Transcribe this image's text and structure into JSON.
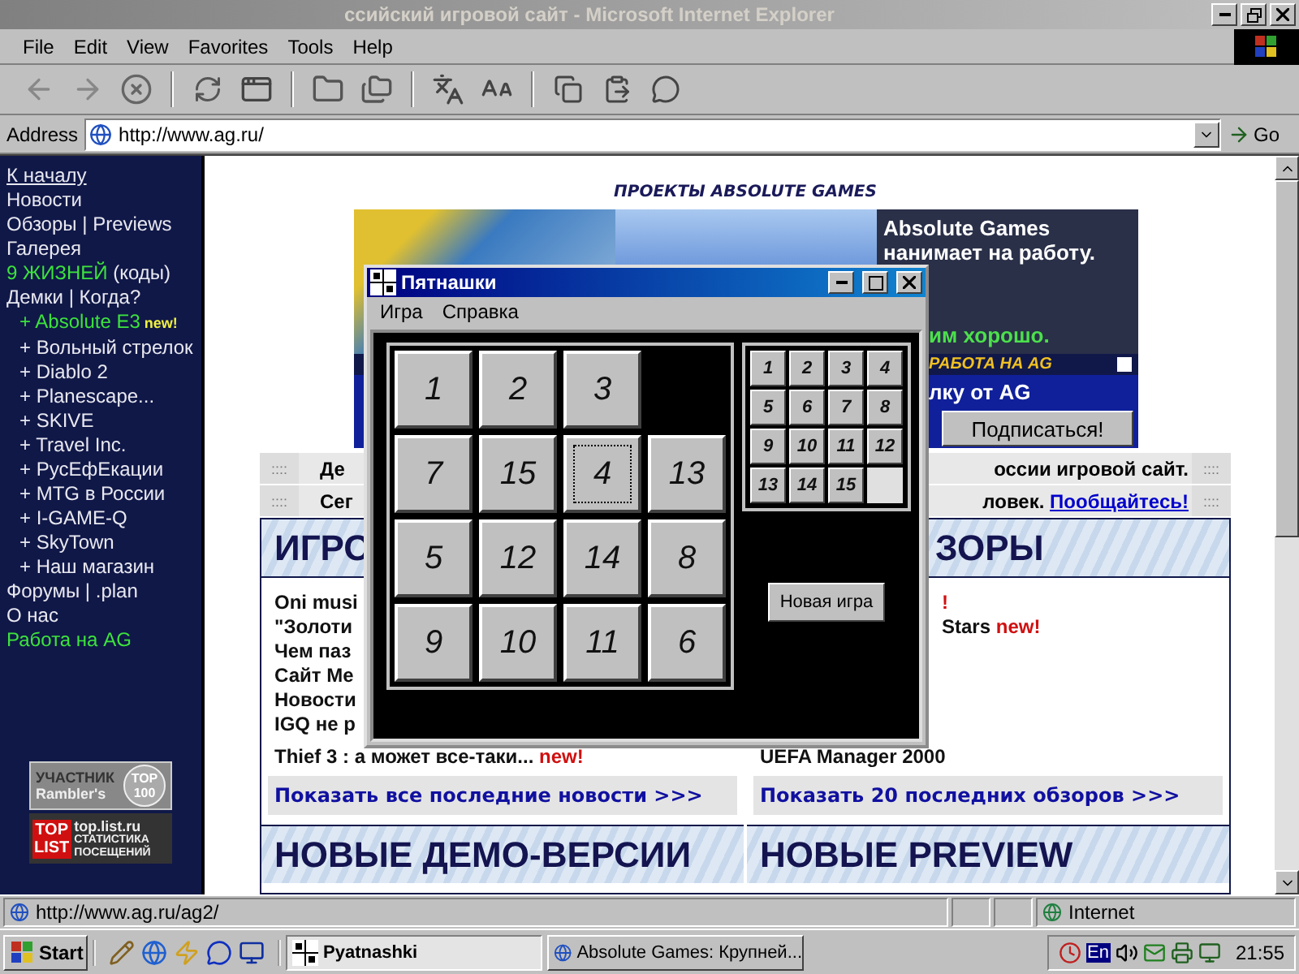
{
  "browser": {
    "title": "ссийский игровой сайт - Microsoft Internet Explorer",
    "menu": [
      "File",
      "Edit",
      "View",
      "Favorites",
      "Tools",
      "Help"
    ],
    "address_label": "Address",
    "address": "http://www.ag.ru/",
    "go": "Go"
  },
  "sidebar": {
    "items": [
      {
        "text": "К началу",
        "kind": "home"
      },
      {
        "text": "Новости",
        "kind": "link"
      },
      {
        "text": "Обзоры | Previews",
        "kind": "link"
      },
      {
        "text": "Галерея",
        "kind": "link"
      },
      {
        "text": "9 ЖИЗНЕЙ",
        "extra": "(коды)",
        "kind": "highlight"
      },
      {
        "text": "Демки | Когда?",
        "kind": "link",
        "children": [
          {
            "text": "+ Absolute E3",
            "badge": "new!",
            "kind": "highlight"
          },
          {
            "text": "+ Вольный стрелок",
            "kind": "link"
          },
          {
            "text": "+ Diablo 2",
            "kind": "link"
          },
          {
            "text": "+ Planescape...",
            "kind": "link"
          },
          {
            "text": "+ SKIVE",
            "kind": "link"
          },
          {
            "text": "+ Travel Inc.",
            "kind": "link"
          },
          {
            "text": "+ РусЕфЕкации",
            "kind": "link"
          },
          {
            "text": "+ MTG в России",
            "kind": "link"
          },
          {
            "text": "+ I-GAME-Q",
            "kind": "link"
          },
          {
            "text": "+ SkyTown",
            "kind": "link"
          },
          {
            "text": "+ Наш магазин",
            "kind": "link"
          }
        ]
      },
      {
        "text": "Форумы | .plan",
        "kind": "link"
      },
      {
        "text": "О нас",
        "kind": "link"
      },
      {
        "text": "Работа на AG",
        "kind": "highlight"
      }
    ],
    "rambler": {
      "top": "УЧАСТНИК",
      "name": "Rambler's",
      "rank": "TOP 100"
    },
    "toplist": {
      "logo": "TOP LIST",
      "site": "top.list.ru",
      "caption": "СТАТИСТИКА ПОСЕЩЕНИЙ"
    }
  },
  "page": {
    "heading": "ПРОЕКТЫ ABSOLUTE GAMES",
    "banner": {
      "title": "Absolute Games нанимает на работу.",
      "tagline": "им хорошо.",
      "strip": "РАБОТА НА AG",
      "subscribe_label": "лку от AG",
      "subscribe_button": "Подписаться!"
    },
    "notices": [
      {
        "marker_left": "::::",
        "left": "Де",
        "right": "оссии игровой сайт.",
        "marker_right": "::::"
      },
      {
        "marker_left": "::::",
        "left": "Сег",
        "right": "ловек.",
        "link": "Пообщайтесь!",
        "marker_right": "::::"
      }
    ],
    "panels": [
      {
        "kind": "head",
        "title": "ИГРО",
        "items": [
          {
            "text": "Oni musi"
          },
          {
            "text": "\"Золоти"
          },
          {
            "text": "Чем паз"
          },
          {
            "text": "Сайт Ме"
          },
          {
            "text": "Новости"
          },
          {
            "text": "IGQ не р"
          }
        ],
        "last_item": {
          "text": "Thief 3 : а может все-таки...",
          "badge": "new!"
        },
        "more": "Показать все последние новости >>>",
        "next_title": "НОВЫЕ ДЕМО-ВЕРСИИ"
      },
      {
        "kind": "tail",
        "title": "ЗОРЫ",
        "items": [
          {
            "badge": "!"
          },
          {
            "text": "Stars",
            "badge": "new!"
          }
        ],
        "last_item": {
          "text": "UEFA Manager 2000"
        },
        "more": "Показать 20 последних обзоров >>>",
        "next_title": "НОВЫЕ PREVIEW"
      }
    ]
  },
  "game": {
    "title": "Пятнашки",
    "menu": [
      "Игра",
      "Справка"
    ],
    "board": [
      {
        "kind": "tile",
        "label": "1",
        "focused": false
      },
      {
        "kind": "tile",
        "label": "2",
        "focused": false
      },
      {
        "kind": "tile",
        "label": "3",
        "focused": false
      },
      {
        "kind": "empty"
      },
      {
        "kind": "tile",
        "label": "7",
        "focused": false
      },
      {
        "kind": "tile",
        "label": "15",
        "focused": false
      },
      {
        "kind": "tile",
        "label": "4",
        "focused": true
      },
      {
        "kind": "tile",
        "label": "13",
        "focused": false
      },
      {
        "kind": "tile",
        "label": "5",
        "focused": false
      },
      {
        "kind": "tile",
        "label": "12",
        "focused": false
      },
      {
        "kind": "tile",
        "label": "14",
        "focused": false
      },
      {
        "kind": "tile",
        "label": "8",
        "focused": false
      },
      {
        "kind": "tile",
        "label": "9",
        "focused": false
      },
      {
        "kind": "tile",
        "label": "10",
        "focused": false
      },
      {
        "kind": "tile",
        "label": "11",
        "focused": false
      },
      {
        "kind": "tile",
        "label": "6",
        "focused": false
      }
    ],
    "target": [
      {
        "kind": "tile",
        "label": "1"
      },
      {
        "kind": "tile",
        "label": "2"
      },
      {
        "kind": "tile",
        "label": "3"
      },
      {
        "kind": "tile",
        "label": "4"
      },
      {
        "kind": "tile",
        "label": "5"
      },
      {
        "kind": "tile",
        "label": "6"
      },
      {
        "kind": "tile",
        "label": "7"
      },
      {
        "kind": "tile",
        "label": "8"
      },
      {
        "kind": "tile",
        "label": "9"
      },
      {
        "kind": "tile",
        "label": "10"
      },
      {
        "kind": "tile",
        "label": "11"
      },
      {
        "kind": "tile",
        "label": "12"
      },
      {
        "kind": "tile",
        "label": "13"
      },
      {
        "kind": "tile",
        "label": "14"
      },
      {
        "kind": "tile",
        "label": "15"
      },
      {
        "kind": "empty"
      }
    ],
    "new_game": "Новая игра"
  },
  "status_bar": {
    "url": "http://www.ag.ru/ag2/",
    "zone": "Internet"
  },
  "taskbar": {
    "start": "Start",
    "tasks": [
      {
        "label": "Pyatnashki",
        "selected": true
      },
      {
        "label": "Absolute Games: Крупней...",
        "selected": false
      }
    ],
    "language": "En",
    "time": "21:55"
  }
}
